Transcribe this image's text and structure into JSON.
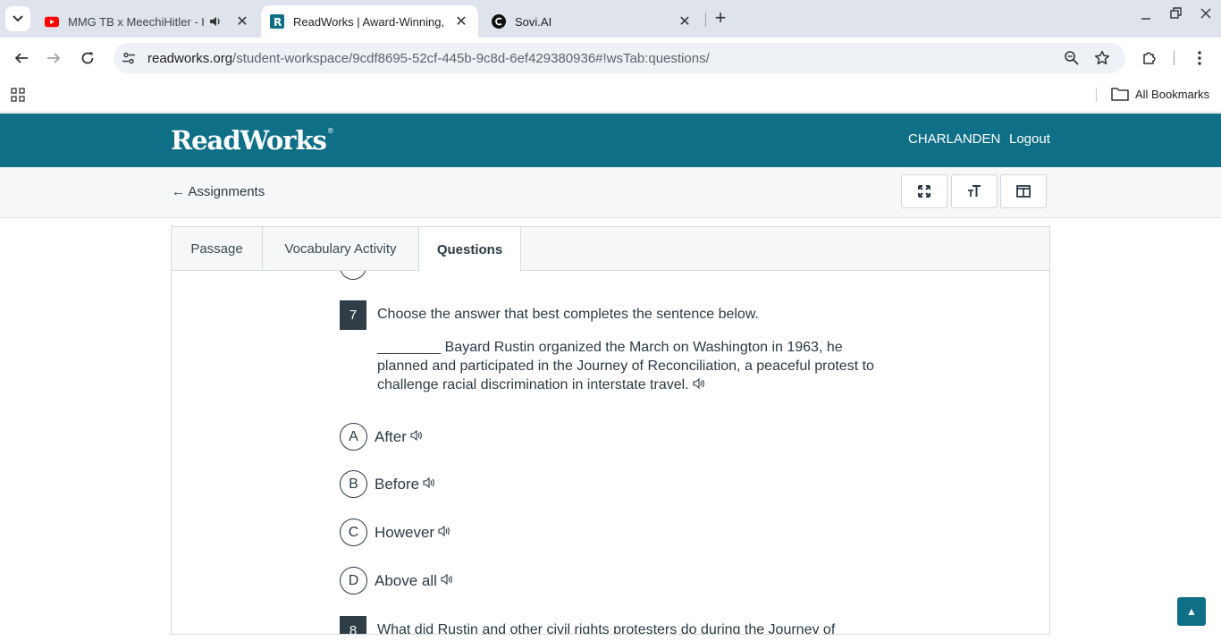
{
  "browser": {
    "tabs": [
      {
        "title": "MMG TB x MeechiHitler - Ko",
        "favicon": "youtube-icon",
        "audio": true
      },
      {
        "title": "ReadWorks | Award-Winning, Ed",
        "favicon": "readworks-icon",
        "active": true
      },
      {
        "title": "Sovi.AI",
        "favicon": "sovi-icon"
      }
    ],
    "url_host": "readworks.org",
    "url_path": "/student-workspace/9cdf8695-52cf-445b-9c8d-6ef429380936#!wsTab:questions/",
    "bookmarks_label": "All Bookmarks",
    "colors": {
      "tabstrip": "#dfe3eb",
      "omnibox": "#eef1f6"
    }
  },
  "header": {
    "logo": "ReadWorks",
    "logo_mark": "®",
    "user": "CHARLANDEN",
    "logout": "Logout",
    "color": "#0f6f86"
  },
  "subbar": {
    "back": "← Assignments",
    "tools": [
      "fullscreen-icon",
      "text-size-icon",
      "split-view-icon"
    ]
  },
  "panel_tabs": {
    "passage": "Passage",
    "vocab": "Vocabulary Activity",
    "questions": "Questions"
  },
  "question7": {
    "number": "7",
    "prompt": "Choose the answer that best completes the sentence below.",
    "sentence_line1": "________ Bayard Rustin organized the March on Washington in 1963, he",
    "sentence_line2": "planned and participated in the Journey of Reconciliation, a peaceful protest to",
    "sentence_line3": "challenge racial discrimination in interstate travel.",
    "choices": [
      {
        "letter": "A",
        "text": "After"
      },
      {
        "letter": "B",
        "text": "Before"
      },
      {
        "letter": "C",
        "text": "However"
      },
      {
        "letter": "D",
        "text": "Above all"
      }
    ]
  },
  "question8": {
    "number": "8",
    "prompt": "What did Rustin and other civil rights protesters do during the Journey of"
  },
  "scroll_top": "▲"
}
